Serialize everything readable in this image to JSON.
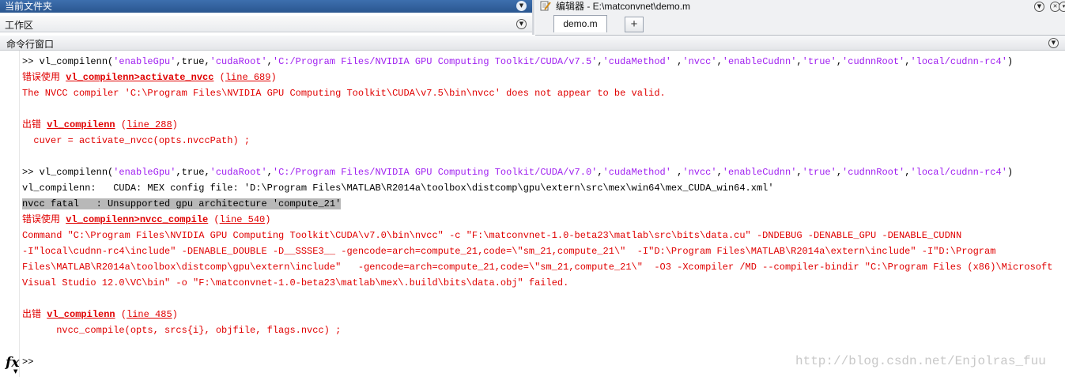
{
  "panels": {
    "current_folder": "当前文件夹",
    "workspace": "工作区",
    "editor_title": "编辑器 - E:\\matconvnet\\demo.m",
    "editor_tab": "demo.m",
    "add_tab": "+",
    "command_window": "命令行窗口"
  },
  "console": {
    "l1": [
      {
        "t": ">> vl_compilenn(",
        "c": "n"
      },
      {
        "t": "'enableGpu'",
        "c": "s"
      },
      {
        "t": ",true,",
        "c": "n"
      },
      {
        "t": "'cudaRoot'",
        "c": "s"
      },
      {
        "t": ",",
        "c": "n"
      },
      {
        "t": "'C:/Program Files/NVIDIA GPU Computing Toolkit/CUDA/v7.5'",
        "c": "s"
      },
      {
        "t": ",",
        "c": "n"
      },
      {
        "t": "'cudaMethod'",
        "c": "s"
      },
      {
        "t": " ,",
        "c": "n"
      },
      {
        "t": "'nvcc'",
        "c": "s"
      },
      {
        "t": ",",
        "c": "n"
      },
      {
        "t": "'enableCudnn'",
        "c": "s"
      },
      {
        "t": ",",
        "c": "n"
      },
      {
        "t": "'true'",
        "c": "s"
      },
      {
        "t": ",",
        "c": "n"
      },
      {
        "t": "'cudnnRoot'",
        "c": "s"
      },
      {
        "t": ",",
        "c": "n"
      },
      {
        "t": "'local/cudnn-rc4'",
        "c": "s"
      },
      {
        "t": ")",
        "c": "n"
      }
    ],
    "l2": [
      {
        "t": "错误使用 ",
        "c": "r"
      },
      {
        "t": "vl_compilenn>activate_nvcc",
        "c": "lb"
      },
      {
        "t": " (",
        "c": "r"
      },
      {
        "t": "line 689",
        "c": "l"
      },
      {
        "t": ")",
        "c": "r"
      }
    ],
    "l3": [
      {
        "t": "The NVCC compiler 'C:\\Program Files\\NVIDIA GPU Computing Toolkit\\CUDA\\v7.5\\bin\\nvcc' does not appear to be valid.",
        "c": "r"
      }
    ],
    "l4": [
      {
        "t": "出错 ",
        "c": "r"
      },
      {
        "t": "vl_compilenn",
        "c": "lb"
      },
      {
        "t": " (",
        "c": "r"
      },
      {
        "t": "line 288",
        "c": "l"
      },
      {
        "t": ")",
        "c": "r"
      }
    ],
    "l5": [
      {
        "t": "  cuver = activate_nvcc(opts.nvccPath) ;",
        "c": "r"
      }
    ],
    "l6": [
      {
        "t": ">> vl_compilenn(",
        "c": "n"
      },
      {
        "t": "'enableGpu'",
        "c": "s"
      },
      {
        "t": ",true,",
        "c": "n"
      },
      {
        "t": "'cudaRoot'",
        "c": "s"
      },
      {
        "t": ",",
        "c": "n"
      },
      {
        "t": "'C:/Program Files/NVIDIA GPU Computing Toolkit/CUDA/v7.0'",
        "c": "s"
      },
      {
        "t": ",",
        "c": "n"
      },
      {
        "t": "'cudaMethod'",
        "c": "s"
      },
      {
        "t": " ,",
        "c": "n"
      },
      {
        "t": "'nvcc'",
        "c": "s"
      },
      {
        "t": ",",
        "c": "n"
      },
      {
        "t": "'enableCudnn'",
        "c": "s"
      },
      {
        "t": ",",
        "c": "n"
      },
      {
        "t": "'true'",
        "c": "s"
      },
      {
        "t": ",",
        "c": "n"
      },
      {
        "t": "'cudnnRoot'",
        "c": "s"
      },
      {
        "t": ",",
        "c": "n"
      },
      {
        "t": "'local/cudnn-rc4'",
        "c": "s"
      },
      {
        "t": ")",
        "c": "n"
      }
    ],
    "l7": [
      {
        "t": "vl_compilenn:   CUDA: MEX config file: 'D:\\Program Files\\MATLAB\\R2014a\\toolbox\\distcomp\\gpu\\extern\\src\\mex\\win64\\mex_CUDA_win64.xml'",
        "c": "n"
      }
    ],
    "l8": [
      {
        "t": "nvcc fatal   : Unsupported gpu architecture 'compute_21'",
        "c": "h"
      }
    ],
    "l9": [
      {
        "t": "错误使用 ",
        "c": "r"
      },
      {
        "t": "vl_compilenn>nvcc_compile",
        "c": "lb"
      },
      {
        "t": " (",
        "c": "r"
      },
      {
        "t": "line 540",
        "c": "l"
      },
      {
        "t": ")",
        "c": "r"
      }
    ],
    "l10": [
      {
        "t": "Command \"C:\\Program Files\\NVIDIA GPU Computing Toolkit\\CUDA\\v7.0\\bin\\nvcc\" -c \"F:\\matconvnet-1.0-beta23\\matlab\\src\\bits\\data.cu\" -DNDEBUG -DENABLE_GPU -DENABLE_CUDNN",
        "c": "r"
      }
    ],
    "l11": [
      {
        "t": "-I\"local\\cudnn-rc4\\include\" -DENABLE_DOUBLE -D__SSSE3__ -gencode=arch=compute_21,code=\\\"sm_21,compute_21\\\"  -I\"D:\\Program Files\\MATLAB\\R2014a\\extern\\include\" -I\"D:\\Program",
        "c": "r"
      }
    ],
    "l12": [
      {
        "t": "Files\\MATLAB\\R2014a\\toolbox\\distcomp\\gpu\\extern\\include\"   -gencode=arch=compute_21,code=\\\"sm_21,compute_21\\\"  -O3 -Xcompiler /MD --compiler-bindir \"C:\\Program Files (x86)\\Microsoft",
        "c": "r"
      }
    ],
    "l13": [
      {
        "t": "Visual Studio 12.0\\VC\\bin\" -o \"F:\\matconvnet-1.0-beta23\\matlab\\mex\\.build\\bits\\data.obj\" failed.",
        "c": "r"
      }
    ],
    "l14": [
      {
        "t": "出错 ",
        "c": "r"
      },
      {
        "t": "vl_compilenn",
        "c": "lb"
      },
      {
        "t": " (",
        "c": "r"
      },
      {
        "t": "line 485",
        "c": "l"
      },
      {
        "t": ")",
        "c": "r"
      }
    ],
    "l15": [
      {
        "t": "      nvcc_compile(opts, srcs{i}, objfile, flags.nvcc) ;",
        "c": "r"
      }
    ],
    "prompt": ">>",
    "fx": "fx",
    "watermark": "http://blog.csdn.net/Enjolras_fuu"
  },
  "colors": {
    "error_red": "#e00000",
    "string_purple": "#a020f0",
    "highlight_gray": "#b8b8b8",
    "panel_blue": "#2f5f9e"
  },
  "icons": {
    "panel_menu": "chevron-down-circle-icon",
    "editor": "edit-pencil-icon",
    "close": "close-icon"
  }
}
